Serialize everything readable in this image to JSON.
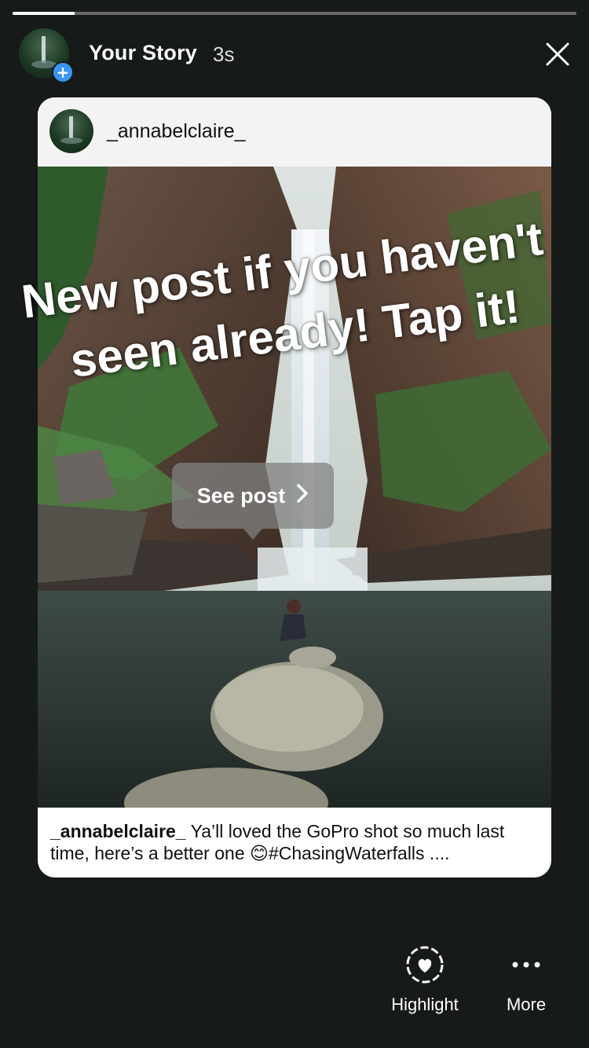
{
  "story": {
    "title": "Your Story",
    "time": "3s",
    "progress": 0.11
  },
  "post": {
    "username": "_annabelclaire_",
    "caption_username": "_annabelclaire_",
    "caption_text": "Ya’ll loved the GoPro shot so much last time, here’s a better one 😊#ChasingWaterfalls ...."
  },
  "overlay": {
    "line1": "New post if you haven't",
    "line2": "seen already! Tap it!"
  },
  "see_post": {
    "label": "See post"
  },
  "actions": {
    "highlight_label": "Highlight",
    "more_label": "More"
  },
  "icons": {
    "avatar": "waterfall-avatar",
    "add_badge": "plus-icon",
    "close": "close-icon",
    "chevron": "chevron-right-icon",
    "highlight": "heart-circle-icon",
    "more": "more-dots-icon"
  },
  "colors": {
    "background": "#161a18",
    "badge": "#3897f0",
    "card": "#ffffff"
  }
}
